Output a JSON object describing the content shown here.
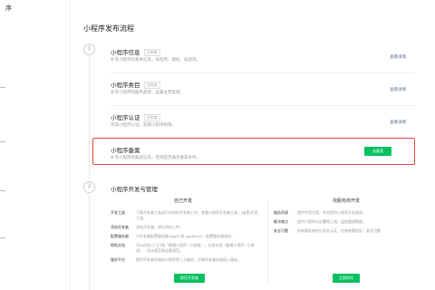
{
  "sidebar": {
    "app_title": "序"
  },
  "main": {
    "title": "小程序发布流程",
    "step1": "1",
    "step2": "2",
    "cards": [
      {
        "title": "小程序信息",
        "badge": "已完成",
        "desc": "补充小程序的基本信息，如名称、图标、描述等。",
        "link": "查看详情"
      },
      {
        "title": "小程序类目",
        "badge": "已完成",
        "desc": "补充小程序的服务类目，设置主营类目。",
        "link": "查看详情"
      },
      {
        "title": "小程序认证",
        "badge": "已完成",
        "desc": "完成小程序认证，获取小程序权限。",
        "link": "查看详情"
      },
      {
        "title": "小程序备案",
        "badge": "",
        "desc": "补充小程序的备案信息，检测是否满足备案条件。",
        "button": "去备案"
      }
    ],
    "dev": {
      "title": "小程序开发与管理",
      "left": {
        "title": "自己开发",
        "rows": [
          {
            "label": "开发工具",
            "text": "下载开发者工具进行代码的开发和上传，查看小程序开发者工具，(或是)开发工具。"
          },
          {
            "label": "添加开发者",
            "text": "添加开发者，进行代码上传。"
          },
          {
            "label": "配置服务器",
            "text": "为开发者配置服务器 AppID 和 AppSecret，配置服务器域名。"
          },
          {
            "label": "帮助文档",
            "text": "可以在接入门门指（普通小程序 / 小游戏），开发文档（普通小程序 / 小游戏），设计规范和运营规范。"
          },
          {
            "label": "服务平台",
            "text": "提供开发者完成的小程序第三方服务，方便开发者快速接入服务。"
          }
        ],
        "button": "前往开发者"
      },
      "right": {
        "title": "找服务商开发",
        "rows": [
          {
            "label": "服务资源",
            "text": "提供专项方案，专业提供小程序开发服务。"
          },
          {
            "label": "解决难点",
            "text": "提供小程序认证整理上线，监控管理数据。"
          },
          {
            "label": "安全可靠",
            "text": "所有服务商经过实名认证，在线查看验证，安全可靠"
          }
        ],
        "button": "立即前往"
      }
    }
  }
}
